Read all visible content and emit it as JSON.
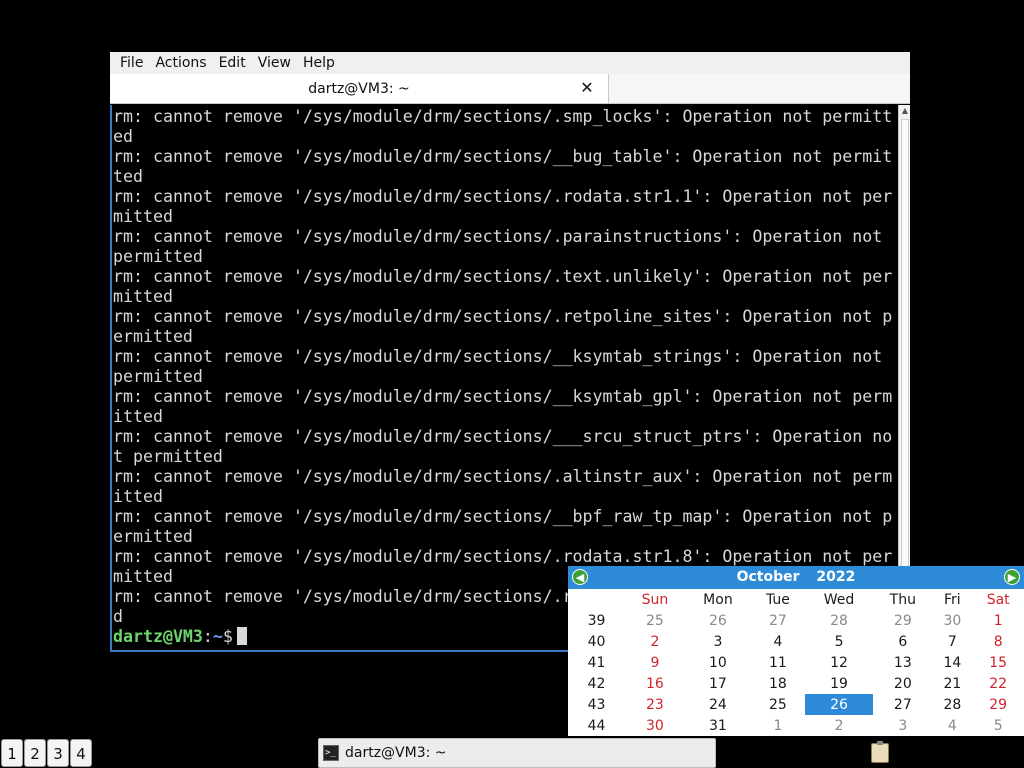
{
  "terminal": {
    "menu": [
      "File",
      "Actions",
      "Edit",
      "View",
      "Help"
    ],
    "tab_title": "dartz@VM3: ~",
    "close_glyph": "✕",
    "lines": [
      "rm: cannot remove '/sys/module/drm/sections/.smp_locks': Operation not permitt",
      "ed",
      "rm: cannot remove '/sys/module/drm/sections/__bug_table': Operation not permit",
      "ted",
      "rm: cannot remove '/sys/module/drm/sections/.rodata.str1.1': Operation not per",
      "mitted",
      "rm: cannot remove '/sys/module/drm/sections/.parainstructions': Operation not",
      "permitted",
      "rm: cannot remove '/sys/module/drm/sections/.text.unlikely': Operation not per",
      "mitted",
      "rm: cannot remove '/sys/module/drm/sections/.retpoline_sites': Operation not p",
      "ermitted",
      "rm: cannot remove '/sys/module/drm/sections/__ksymtab_strings': Operation not",
      "permitted",
      "rm: cannot remove '/sys/module/drm/sections/__ksymtab_gpl': Operation not perm",
      "itted",
      "rm: cannot remove '/sys/module/drm/sections/___srcu_struct_ptrs': Operation no",
      "t permitted",
      "rm: cannot remove '/sys/module/drm/sections/.altinstr_aux': Operation not perm",
      "itted",
      "rm: cannot remove '/sys/module/drm/sections/__bpf_raw_tp_map': Operation not p",
      "ermitted",
      "rm: cannot remove '/sys/module/drm/sections/.rodata.str1.8': Operation not per",
      "mitted",
      "rm: cannot remove '/sys/module/drm/sections/.r",
      "d"
    ],
    "prompt_user": "dartz@VM3",
    "prompt_sep": ":",
    "prompt_path": "~",
    "prompt_symbol": "$"
  },
  "calendar": {
    "month": "October",
    "year": "2022",
    "prev_glyph": "◀",
    "next_glyph": "▶",
    "weekdays": [
      "Sun",
      "Mon",
      "Tue",
      "Wed",
      "Thu",
      "Fri",
      "Sat"
    ],
    "weeks": [
      {
        "num": "39",
        "days": [
          "25",
          "26",
          "27",
          "28",
          "29",
          "30",
          "1"
        ]
      },
      {
        "num": "40",
        "days": [
          "2",
          "3",
          "4",
          "5",
          "6",
          "7",
          "8"
        ]
      },
      {
        "num": "41",
        "days": [
          "9",
          "10",
          "11",
          "12",
          "13",
          "14",
          "15"
        ]
      },
      {
        "num": "42",
        "days": [
          "16",
          "17",
          "18",
          "19",
          "20",
          "21",
          "22"
        ]
      },
      {
        "num": "43",
        "days": [
          "23",
          "24",
          "25",
          "26",
          "27",
          "28",
          "29"
        ]
      },
      {
        "num": "44",
        "days": [
          "30",
          "31",
          "1",
          "2",
          "3",
          "4",
          "5"
        ]
      }
    ],
    "today": "26",
    "colors": {
      "header": "#2e8bd7",
      "weekend": "#d2232a",
      "muted": "#8a8a8a"
    }
  },
  "taskbar": {
    "workspaces": [
      "1",
      "2",
      "3",
      "4"
    ],
    "task_label": "dartz@VM3: ~",
    "task_icon": "terminal-icon",
    "tray_icon": "clipboard-icon"
  }
}
